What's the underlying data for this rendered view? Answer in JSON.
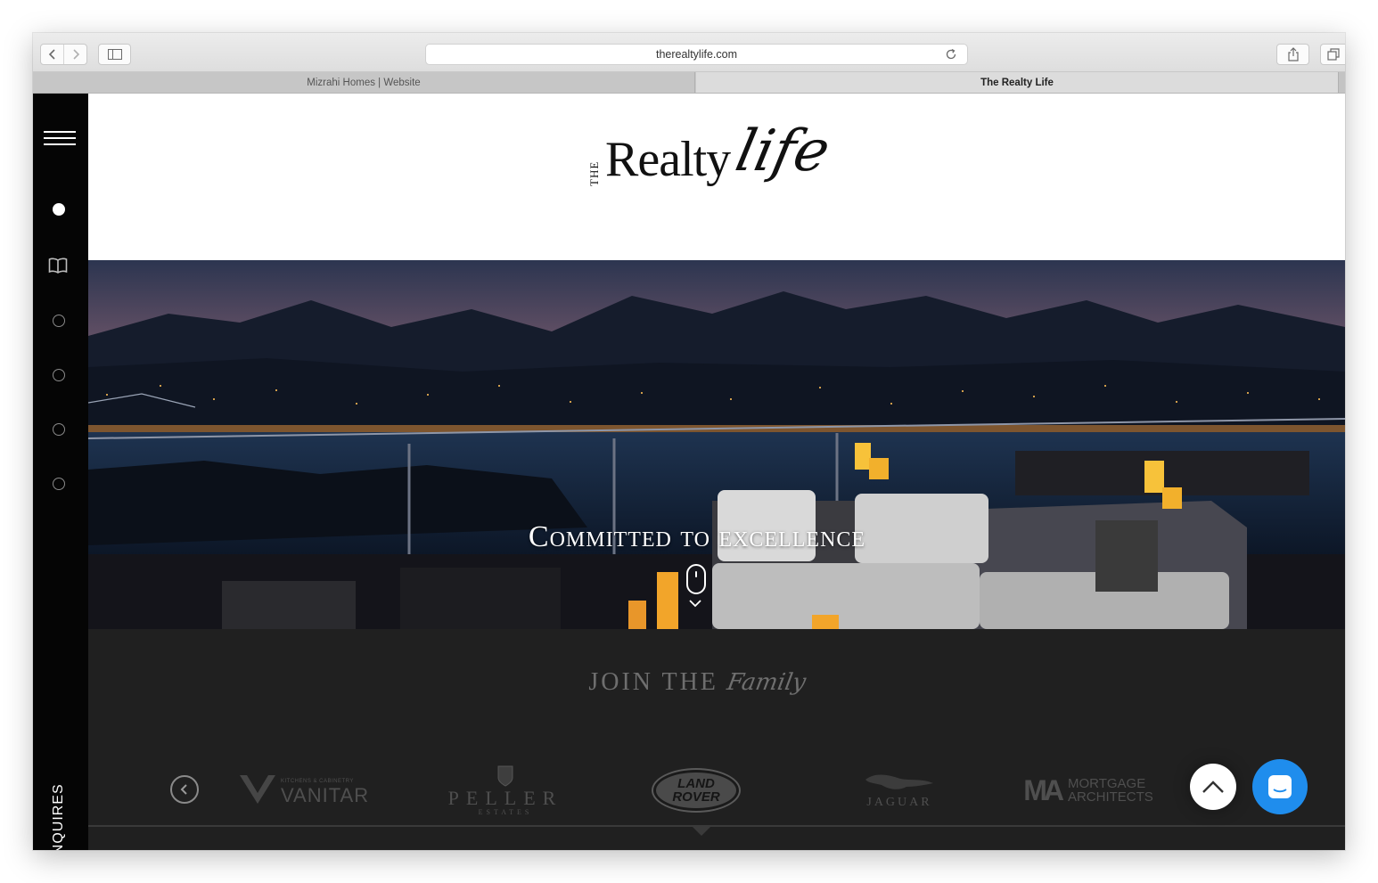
{
  "browser": {
    "url": "therealtylife.com",
    "tabs": [
      {
        "label": "Mizrahi Homes | Website",
        "active": false
      },
      {
        "label": "The Realty Life",
        "active": true
      }
    ]
  },
  "sidebar": {
    "items": [
      "menu-icon",
      "home-dot",
      "book-icon",
      "section-dot",
      "section-dot",
      "section-dot",
      "section-dot"
    ],
    "inquires_label": "INQUIRES"
  },
  "logo": {
    "the": "THE",
    "realty": "Realty",
    "life": "life"
  },
  "hero": {
    "headline": "Committed to excellence"
  },
  "family": {
    "title_prefix": "JOIN THE",
    "title_script": "Family",
    "brands": [
      {
        "name": "VANITAR",
        "sub": "KITCHENS & CABINETRY"
      },
      {
        "name": "PELLER",
        "sub": "ESTATES"
      },
      {
        "name": "LAND ROVER",
        "line1": "LAND",
        "line2": "ROVER"
      },
      {
        "name": "JAGUAR"
      },
      {
        "name": "MORTGAGE ARCHITECTS",
        "mark": "MA",
        "line1": "MORTGAGE",
        "line2": "ARCHITECTS"
      }
    ]
  },
  "colors": {
    "sidebar": "#050505",
    "family_bg": "#202020",
    "chat_button": "#1f8ded"
  }
}
